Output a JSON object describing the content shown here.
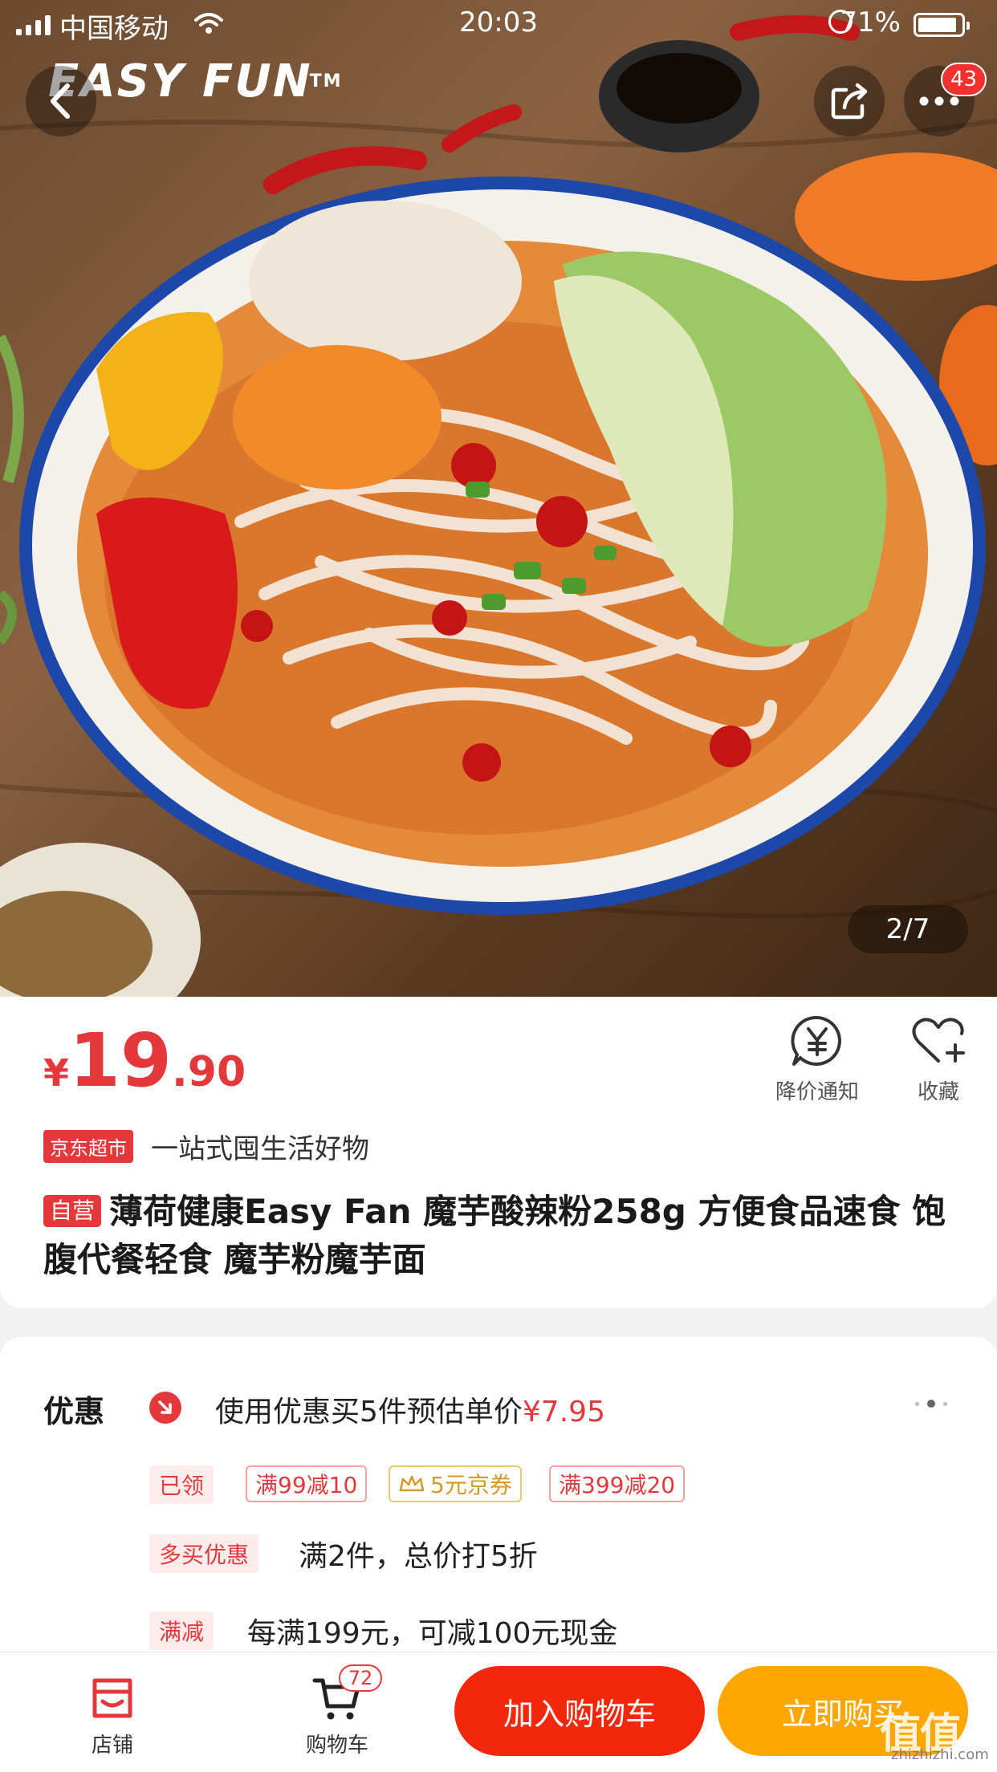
{
  "status_bar": {
    "carrier": "中国移动",
    "time": "20:03",
    "battery_text": "71%"
  },
  "hero": {
    "brand_logo": "EASY FUN",
    "brand_tm": "TM",
    "image_counter": "2/7",
    "more_badge": "43"
  },
  "product": {
    "price_symbol": "¥",
    "price_integer": "19",
    "price_decimal": ".90",
    "price_notice_label": "降价通知",
    "favorite_label": "收藏",
    "store_tag": "京东超市",
    "store_slogan": "一站式囤生活好物",
    "self_operated_tag": "自营",
    "title": "薄荷健康Easy Fan 魔芋酸辣粉258g 方便食品速食 饱腹代餐轻食 魔芋粉魔芋面"
  },
  "promotions": {
    "label": "优惠",
    "main_text": "使用优惠买5件预估单价",
    "main_price": "¥7.95",
    "claimed_tag": "已领",
    "coupons": [
      "满99减10",
      "5元京券",
      "满399减20"
    ],
    "multi_buy_tag": "多买优惠",
    "multi_buy_text": "满2件，总价打5折",
    "full_reduction_tag": "满减",
    "full_reduction_text": "每满199元，可减100元现金"
  },
  "bottom_bar": {
    "shop_label": "店铺",
    "cart_label": "购物车",
    "cart_badge": "72",
    "add_to_cart": "加入购物车",
    "buy_now": "立即购买"
  },
  "watermark": {
    "main": "值值值",
    "sub": "zhizhizhi.com"
  },
  "colors": {
    "jd_red": "#e4393c",
    "add_cart_red": "#f2270c",
    "buy_now_orange": "#ffa600"
  }
}
